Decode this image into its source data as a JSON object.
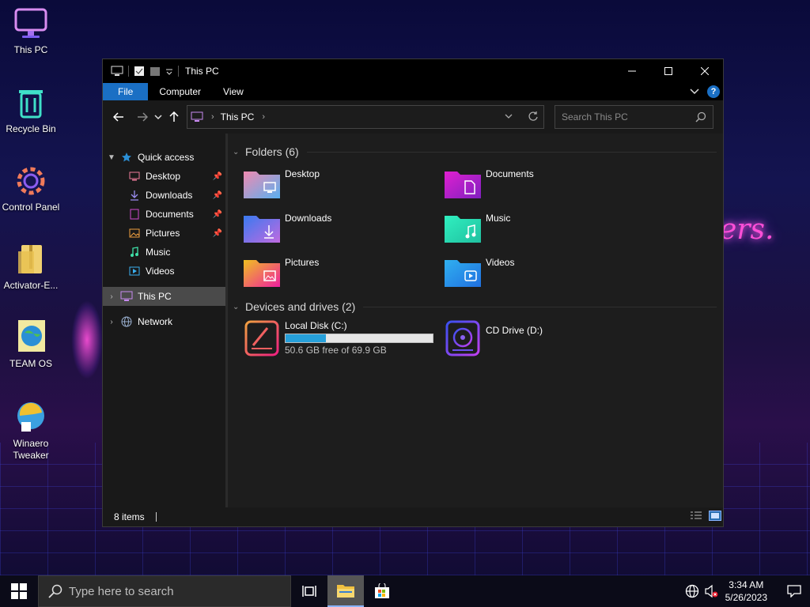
{
  "desktop": {
    "icons": [
      {
        "label": "This PC",
        "icon": "computer-icon"
      },
      {
        "label": "Recycle Bin",
        "icon": "recycle-bin-icon"
      },
      {
        "label": "Control Panel",
        "icon": "gear-icon"
      },
      {
        "label": "Activator-E...",
        "icon": "zip-folder-icon"
      },
      {
        "label": "TEAM OS",
        "icon": "globe-icon"
      },
      {
        "label": "Winaero Tweaker",
        "icon": "winaero-icon"
      }
    ],
    "wallpaper_text": "ers."
  },
  "window": {
    "title": "This PC",
    "ribbon_tabs": [
      "File",
      "Computer",
      "View"
    ],
    "address": {
      "crumb": "This PC"
    },
    "search": {
      "placeholder": "Search This PC"
    },
    "nav_pane": {
      "quick_access": "Quick access",
      "quick_items": [
        {
          "label": "Desktop",
          "pinned": true
        },
        {
          "label": "Downloads",
          "pinned": true
        },
        {
          "label": "Documents",
          "pinned": true
        },
        {
          "label": "Pictures",
          "pinned": true
        },
        {
          "label": "Music",
          "pinned": false
        },
        {
          "label": "Videos",
          "pinned": false
        }
      ],
      "this_pc": "This PC",
      "network": "Network"
    },
    "folders_header": "Folders (6)",
    "folders": [
      "Desktop",
      "Documents",
      "Downloads",
      "Music",
      "Pictures",
      "Videos"
    ],
    "drives_header": "Devices and drives (2)",
    "drives": [
      {
        "name": "Local Disk (C:)",
        "free": "50.6 GB free of 69.9 GB",
        "used_fraction": 0.276
      },
      {
        "name": "CD Drive (D:)"
      }
    ],
    "status": "8 items"
  },
  "taskbar": {
    "search_placeholder": "Type here to search",
    "time": "3:34 AM",
    "date": "5/26/2023"
  },
  "colors": {
    "accent": "#1a6fc4",
    "drive_fill": "#26a0da"
  }
}
